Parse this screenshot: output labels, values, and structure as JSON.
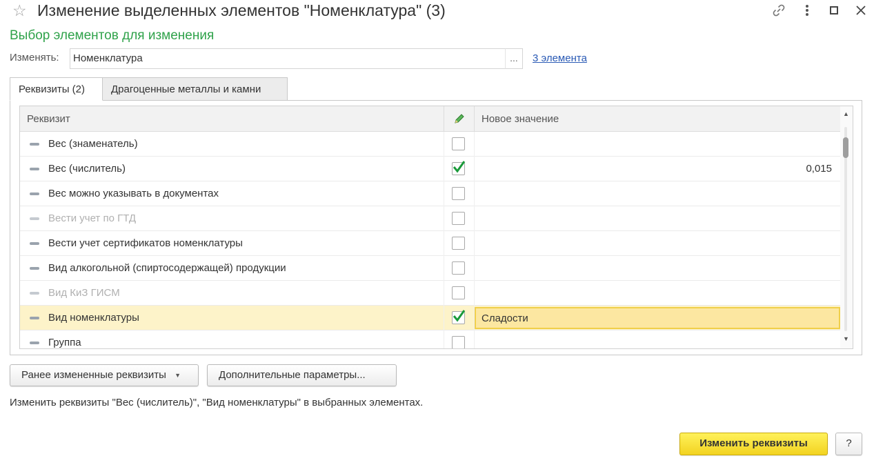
{
  "window": {
    "title": "Изменение выделенных элементов \"Номенклатура\" (3)",
    "icons": [
      "star-icon",
      "link-icon",
      "more-icon",
      "maximize-icon",
      "close-icon"
    ]
  },
  "section_title": "Выбор элементов для изменения",
  "change": {
    "label": "Изменять:",
    "value": "Номенклатура",
    "select_button": "...",
    "elements_link": "3 элемента"
  },
  "tabs": [
    {
      "label": "Реквизиты (2)",
      "active": true
    },
    {
      "label": "Драгоценные металлы и камни",
      "active": false
    }
  ],
  "grid": {
    "columns": {
      "attribute": "Реквизит",
      "edit_icon": "pencil-icon",
      "new_value": "Новое значение"
    },
    "rows": [
      {
        "name": "Вес (знаменатель)",
        "checked": false,
        "value": "",
        "disabled": false
      },
      {
        "name": "Вес (числитель)",
        "checked": true,
        "value": "0,015",
        "disabled": false
      },
      {
        "name": "Вес можно указывать в документах",
        "checked": false,
        "value": "",
        "disabled": false
      },
      {
        "name": "Вести учет по ГТД",
        "checked": false,
        "value": "",
        "disabled": true
      },
      {
        "name": "Вести учет сертификатов номенклатуры",
        "checked": false,
        "value": "",
        "disabled": false
      },
      {
        "name": "Вид алкогольной (спиртосодержащей) продукции",
        "checked": false,
        "value": "",
        "disabled": false
      },
      {
        "name": "Вид КиЗ ГИСМ",
        "checked": false,
        "value": "",
        "disabled": true
      },
      {
        "name": "Вид номенклатуры",
        "checked": true,
        "value": "Сладости",
        "disabled": false,
        "selected": true
      },
      {
        "name": "Группа",
        "checked": false,
        "value": "",
        "disabled": false
      }
    ]
  },
  "buttons": {
    "previously_changed": "Ранее измененные реквизиты",
    "additional_params": "Дополнительные параметры...",
    "apply": "Изменить реквизиты",
    "help": "?"
  },
  "status_text": "Изменить реквизиты \"Вес (числитель)\", \"Вид номенклатуры\" в выбранных элементах.",
  "colors": {
    "accent_green": "#2fa24a",
    "link_blue": "#2a5ab5",
    "selected_row": "#fdf3c9",
    "apply_button": "#f7e13a",
    "check_green": "#1a9a3a"
  }
}
